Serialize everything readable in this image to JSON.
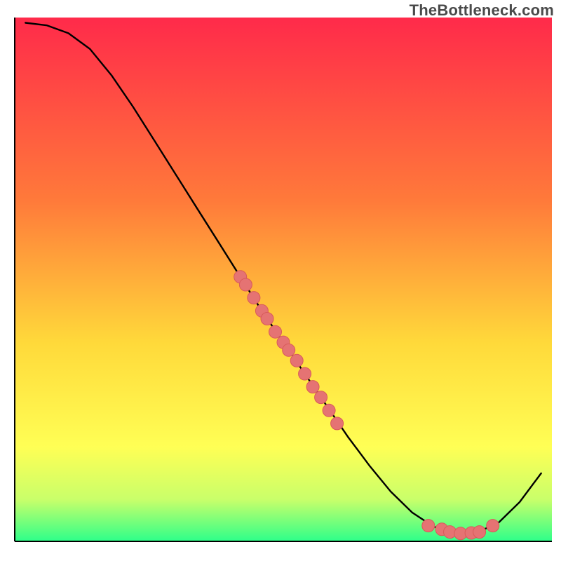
{
  "watermark": "TheBottleneck.com",
  "colors": {
    "gradient_top": "#ff2a4a",
    "gradient_mid_upper": "#ff7a3a",
    "gradient_mid": "#ffd93a",
    "gradient_mid_lower": "#ffff55",
    "gradient_lower": "#c9ff6a",
    "gradient_bottom": "#2dff8a",
    "curve": "#000000",
    "axis": "#000000",
    "point_fill": "#e57373",
    "point_stroke": "#d85a5a"
  },
  "chart_data": {
    "type": "line",
    "title": "",
    "xlabel": "",
    "ylabel": "",
    "xlim": [
      0,
      100
    ],
    "ylim": [
      0,
      100
    ],
    "grid": false,
    "legend": false,
    "series": [
      {
        "name": "curve",
        "x": [
          2,
          6,
          10,
          14,
          18,
          22,
          26,
          30,
          34,
          38,
          42,
          46,
          50,
          54,
          58,
          62,
          66,
          70,
          74,
          78,
          82,
          84,
          86,
          90,
          94,
          98
        ],
        "y": [
          99,
          98.5,
          97,
          94,
          89,
          83,
          76.5,
          70,
          63.5,
          57,
          50.5,
          44,
          38,
          32,
          26,
          20,
          14.5,
          9.5,
          5.5,
          2.8,
          1.6,
          1.5,
          1.7,
          3.5,
          7.5,
          13
        ]
      }
    ],
    "scatter_points": [
      {
        "x": 42,
        "y": 50.5
      },
      {
        "x": 43,
        "y": 49
      },
      {
        "x": 44.5,
        "y": 46.5
      },
      {
        "x": 46,
        "y": 44
      },
      {
        "x": 47,
        "y": 42.5
      },
      {
        "x": 48.5,
        "y": 40
      },
      {
        "x": 50,
        "y": 38
      },
      {
        "x": 51,
        "y": 36.5
      },
      {
        "x": 52.5,
        "y": 34.5
      },
      {
        "x": 54,
        "y": 32
      },
      {
        "x": 55.5,
        "y": 29.5
      },
      {
        "x": 57,
        "y": 27.5
      },
      {
        "x": 58.5,
        "y": 25
      },
      {
        "x": 60,
        "y": 22.5
      },
      {
        "x": 77,
        "y": 3.0
      },
      {
        "x": 79.5,
        "y": 2.3
      },
      {
        "x": 81,
        "y": 1.8
      },
      {
        "x": 83,
        "y": 1.5
      },
      {
        "x": 85,
        "y": 1.6
      },
      {
        "x": 86.5,
        "y": 1.8
      },
      {
        "x": 89,
        "y": 3.0
      }
    ],
    "point_radius": 9
  }
}
